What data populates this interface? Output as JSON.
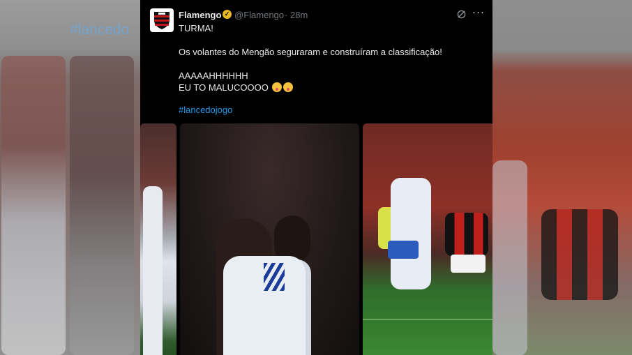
{
  "background": {
    "blurred_hashtag": "#lancedo"
  },
  "tweet": {
    "author_name": "Flamengo",
    "verified_badge": "gold-checkmark-icon",
    "handle": "@Flamengo",
    "separator": "·",
    "time_ago": "28m",
    "lines": [
      "TURMA!",
      "Os volantes do Mengão seguraram e construíram a classificação!",
      "AAAAAHHHHHH",
      "EU TO MALUCOOOO"
    ],
    "emojis": [
      "zany-face-emoji",
      "zany-face-emoji"
    ],
    "hashtag": "#lancedojogo",
    "more_label": "···",
    "colors": {
      "background": "#000000",
      "text": "#e7e9ea",
      "secondary": "#71767b",
      "link": "#1d9bf0",
      "badge": "#e8b824"
    }
  },
  "media": [
    {
      "description": "cropped-match-photo"
    },
    {
      "description": "cruzeiro-players-photo"
    },
    {
      "description": "flamengo-vs-cruzeiro-action-photo"
    }
  ]
}
